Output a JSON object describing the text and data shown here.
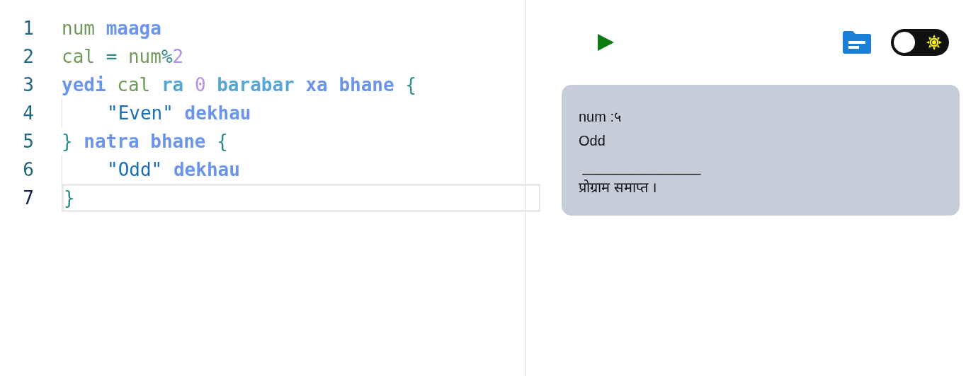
{
  "editor": {
    "lines": [
      {
        "number": "1",
        "active": false,
        "indent": false,
        "tokens": [
          {
            "kind": "var",
            "text": "num"
          },
          {
            "kind": "kw",
            "text": "maaga"
          }
        ]
      },
      {
        "number": "2",
        "active": false,
        "indent": false,
        "tokens": [
          {
            "kind": "var",
            "text": "cal"
          },
          {
            "kind": "op",
            "text": "="
          },
          {
            "kind": "var",
            "text": "num"
          },
          {
            "kind": "op",
            "text": "%",
            "join": true
          },
          {
            "kind": "num",
            "text": "2",
            "join": true
          }
        ]
      },
      {
        "number": "3",
        "active": false,
        "indent": false,
        "tokens": [
          {
            "kind": "kw",
            "text": "yedi"
          },
          {
            "kind": "var",
            "text": "cal"
          },
          {
            "kind": "kw2",
            "text": "ra"
          },
          {
            "kind": "num",
            "text": "0"
          },
          {
            "kind": "kw2",
            "text": "barabar"
          },
          {
            "kind": "kw",
            "text": "xa"
          },
          {
            "kind": "kw",
            "text": "bhane"
          },
          {
            "kind": "op",
            "text": "{"
          }
        ]
      },
      {
        "number": "4",
        "active": false,
        "indent": true,
        "tokens": [
          {
            "kind": "str",
            "text": "\"Even\""
          },
          {
            "kind": "kw",
            "text": "dekhau"
          }
        ]
      },
      {
        "number": "5",
        "active": false,
        "indent": false,
        "tokens": [
          {
            "kind": "op",
            "text": "}"
          },
          {
            "kind": "kw",
            "text": "natra"
          },
          {
            "kind": "kw",
            "text": "bhane"
          },
          {
            "kind": "op",
            "text": "{"
          }
        ]
      },
      {
        "number": "6",
        "active": false,
        "indent": true,
        "tokens": [
          {
            "kind": "str",
            "text": "\"Odd\""
          },
          {
            "kind": "kw",
            "text": "dekhau"
          }
        ]
      },
      {
        "number": "7",
        "active": true,
        "indent": false,
        "tokens": [
          {
            "kind": "op",
            "text": "}"
          }
        ]
      }
    ]
  },
  "toolbar": {
    "theme_toggle": {
      "on": false
    }
  },
  "output": {
    "lines": [
      "num :५",
      "Odd",
      " _______________",
      "प्रोग्राम समाप्त ।"
    ]
  }
}
